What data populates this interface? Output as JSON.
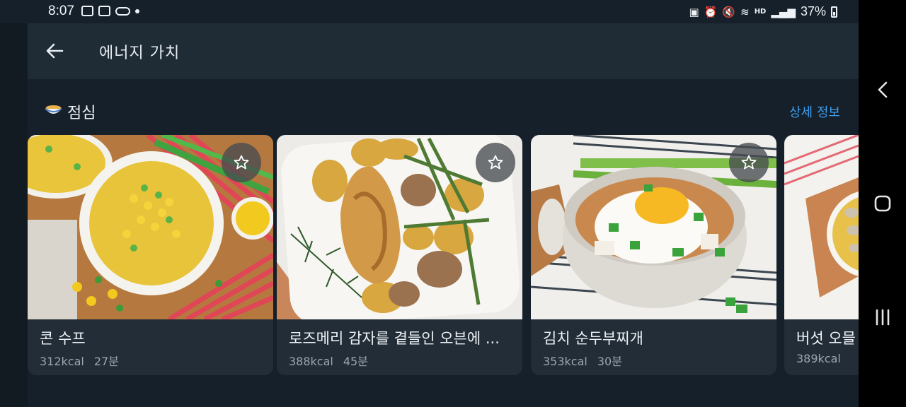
{
  "status_bar": {
    "time": "8:07",
    "battery_percent": "37%",
    "network_label": "HD"
  },
  "header": {
    "title": "에너지 가치"
  },
  "section": {
    "title": "점심",
    "details_link": "상세 정보"
  },
  "recipes": [
    {
      "name": "콘 수프",
      "kcal": "312kcal",
      "time": "27분"
    },
    {
      "name": "로즈메리 감자를 곁들인 오븐에 ...",
      "kcal": "388kcal",
      "time": "45분"
    },
    {
      "name": "김치 순두부찌개",
      "kcal": "353kcal",
      "time": "30분"
    },
    {
      "name": "버섯 오믈",
      "kcal": "389kcal",
      "time": ""
    }
  ],
  "colors": {
    "background": "#15202a",
    "app_bar": "#1f2b35",
    "card": "#222d37",
    "accent_link": "#3d9ff0"
  },
  "icons": {
    "back": "arrow-left-icon",
    "section": "bowl-icon",
    "favorite": "star-outline-icon",
    "nav_back": "chevron-left-icon",
    "nav_home": "home-icon",
    "nav_recents": "recents-icon"
  }
}
